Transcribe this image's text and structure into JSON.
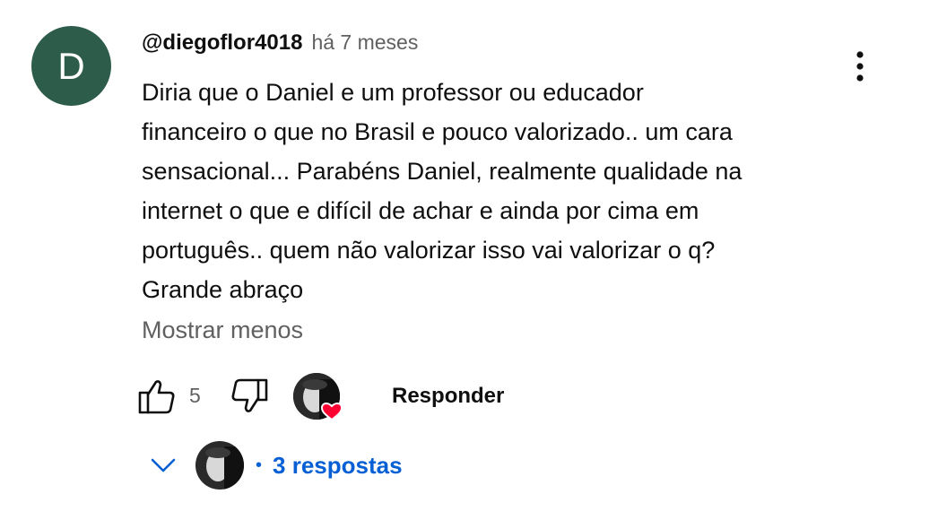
{
  "comment": {
    "avatar_letter": "D",
    "avatar_color": "#2d5c4a",
    "author": "@diegoflor4018",
    "time": "há 7 meses",
    "text_lines": [
      "Diria que o Daniel e um professor ou educador",
      "financeiro o que no Brasil e pouco valorizado.. um cara",
      "sensacional... Parabéns Daniel, realmente qualidade na",
      "internet o que e difícil de achar e ainda por cima em",
      "português.. quem não valorizar isso vai valorizar o q?",
      "Grande abraço"
    ],
    "show_less": "Mostrar menos"
  },
  "actions": {
    "like_icon": "thumb-up-icon",
    "like_count": "5",
    "dislike_icon": "thumb-down-icon",
    "heart_icon": "creator-heart-icon",
    "reply_label": "Responder"
  },
  "replies": {
    "chevron_icon": "chevron-down-icon",
    "dot": "•",
    "label": "3 respostas",
    "accent": "#065fd4"
  },
  "menu_icon": "more-vert-icon"
}
